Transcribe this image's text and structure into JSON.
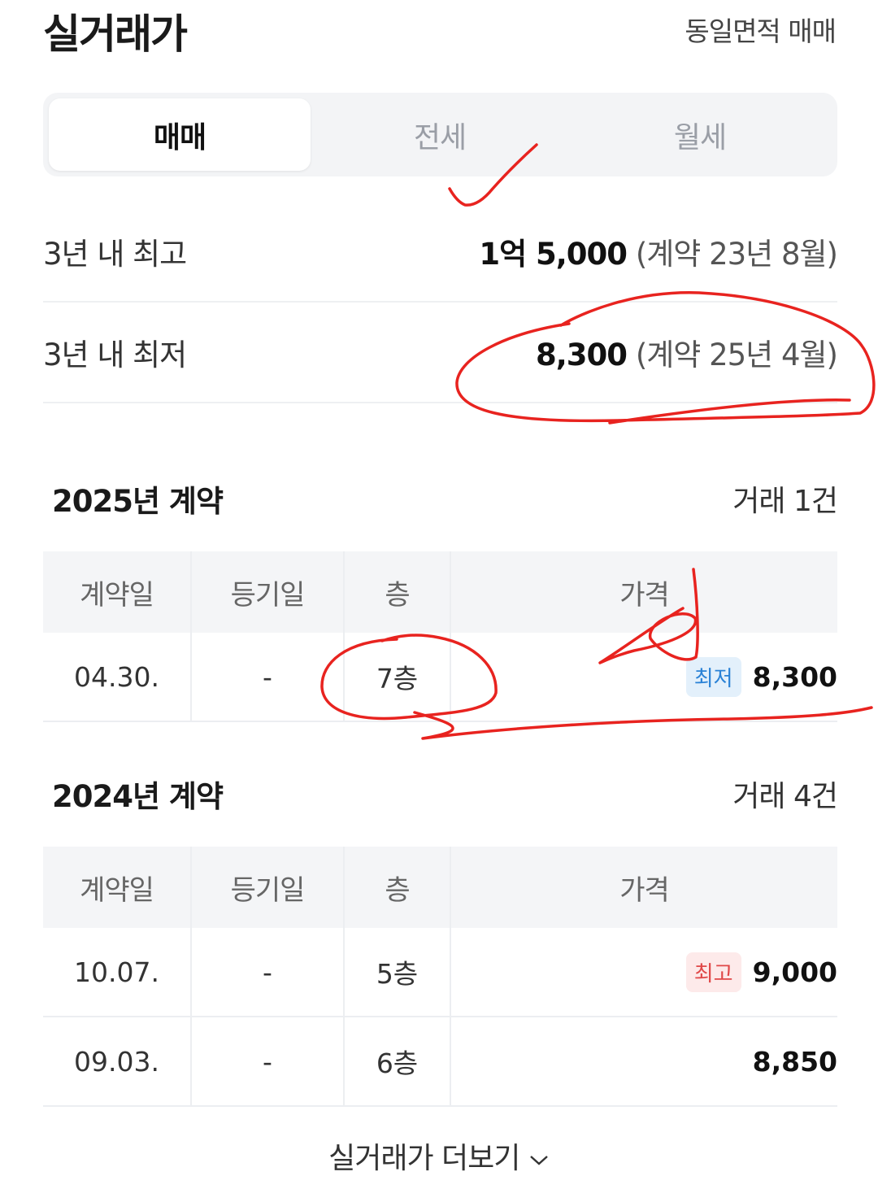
{
  "header": {
    "title": "실거래가",
    "same_area_link": "동일면적 매매"
  },
  "tabs": [
    {
      "label": "매매",
      "active": true
    },
    {
      "label": "전세",
      "active": false
    },
    {
      "label": "월세",
      "active": false
    }
  ],
  "summary": {
    "high": {
      "label": "3년 내 최고",
      "value": "1억 5,000",
      "detail": "(계약 23년 8월)"
    },
    "low": {
      "label": "3년 내 최저",
      "value": "8,300",
      "detail": "(계약 25년 4월)"
    }
  },
  "columns": [
    "계약일",
    "등기일",
    "층",
    "가격"
  ],
  "sections": [
    {
      "title": "2025년 계약",
      "count": "거래 1건",
      "rows": [
        {
          "date": "04.30.",
          "reg": "-",
          "floor": "7층",
          "badge": "최저",
          "price": "8,300"
        }
      ]
    },
    {
      "title": "2024년 계약",
      "count": "거래 4건",
      "rows": [
        {
          "date": "10.07.",
          "reg": "-",
          "floor": "5층",
          "badge": "최고",
          "price": "9,000"
        },
        {
          "date": "09.03.",
          "reg": "-",
          "floor": "6층",
          "badge": "",
          "price": "8,850"
        }
      ]
    }
  ],
  "more_label": "실거래가 더보기",
  "colors": {
    "annotation": "#e8231f",
    "badge_low": "#2a82d6",
    "badge_high": "#e04848"
  }
}
